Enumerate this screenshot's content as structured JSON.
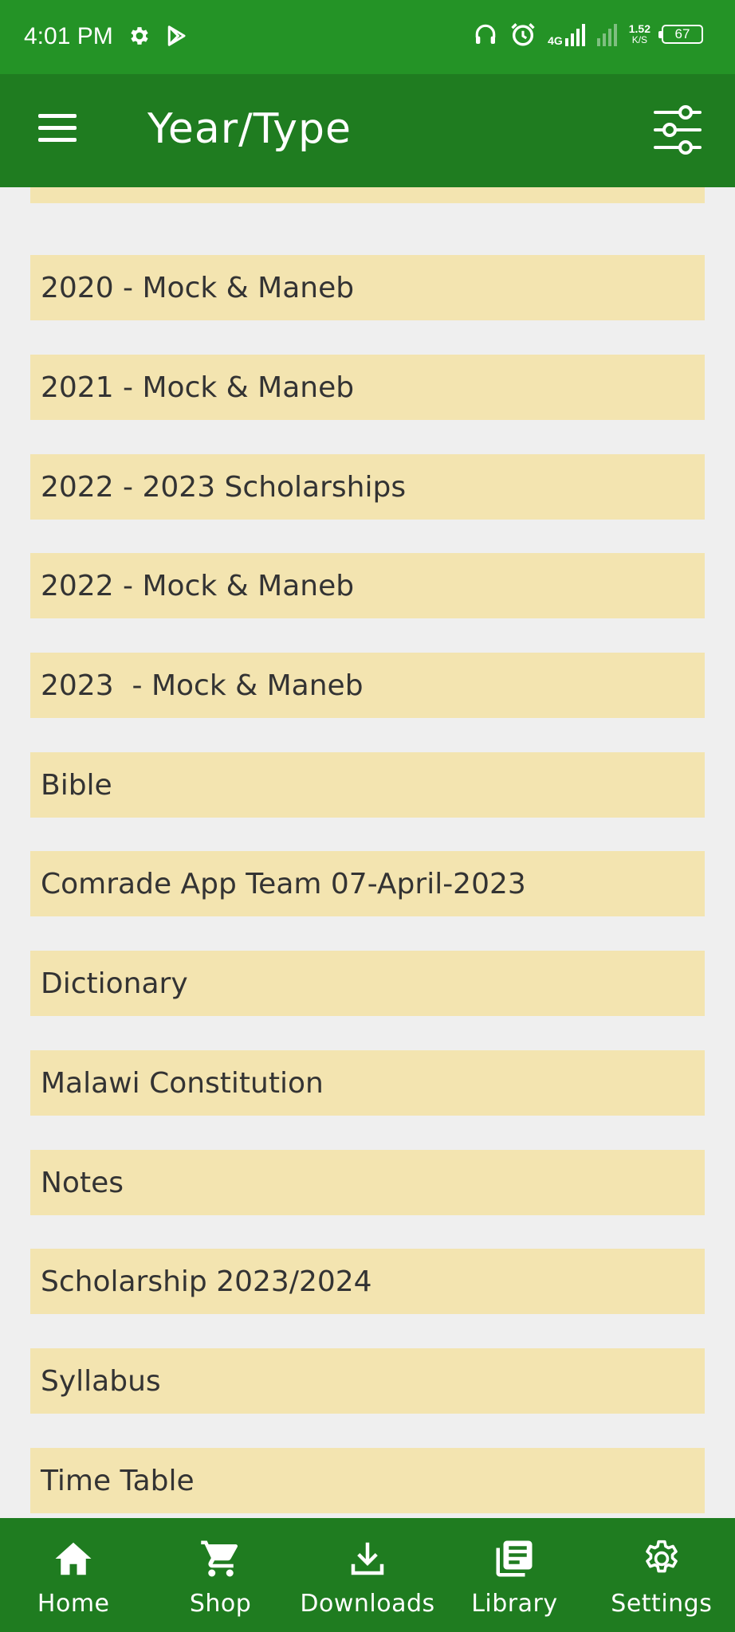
{
  "status_bar": {
    "time": "4:01 PM",
    "network_type": "4G",
    "net_speed": "1.52",
    "net_speed_unit": "K/S",
    "battery": "67",
    "icons": [
      "settings-icon",
      "play-store-icon",
      "headset-icon",
      "alarm-icon",
      "signal-icon",
      "signal-weak-icon",
      "battery-icon"
    ]
  },
  "app_bar": {
    "title": "Year/Type",
    "icons": [
      "menu-icon",
      "filter-sliders-icon"
    ]
  },
  "list": {
    "items": [
      "",
      "2020 - Mock & Maneb",
      "2021 - Mock & Maneb",
      "2022 - 2023 Scholarships",
      "2022 - Mock & Maneb",
      "2023  - Mock & Maneb",
      "Bible",
      "Comrade App Team 07-April-2023",
      "Dictionary",
      "Malawi Constitution",
      "Notes",
      "Scholarship 2023/2024",
      "Syllabus",
      "Time Table"
    ]
  },
  "bottom_nav": {
    "items": [
      {
        "label": "Home",
        "icon": "home-icon"
      },
      {
        "label": "Shop",
        "icon": "cart-icon"
      },
      {
        "label": "Downloads",
        "icon": "download-icon"
      },
      {
        "label": "Library",
        "icon": "library-icon"
      },
      {
        "label": "Settings",
        "icon": "settings-icon"
      }
    ]
  },
  "colors": {
    "status_bar": "#249326",
    "app_bar": "#1f7c20",
    "list_item_bg": "#f3e4b0",
    "page_bg": "#efefef",
    "text": "#333333"
  }
}
